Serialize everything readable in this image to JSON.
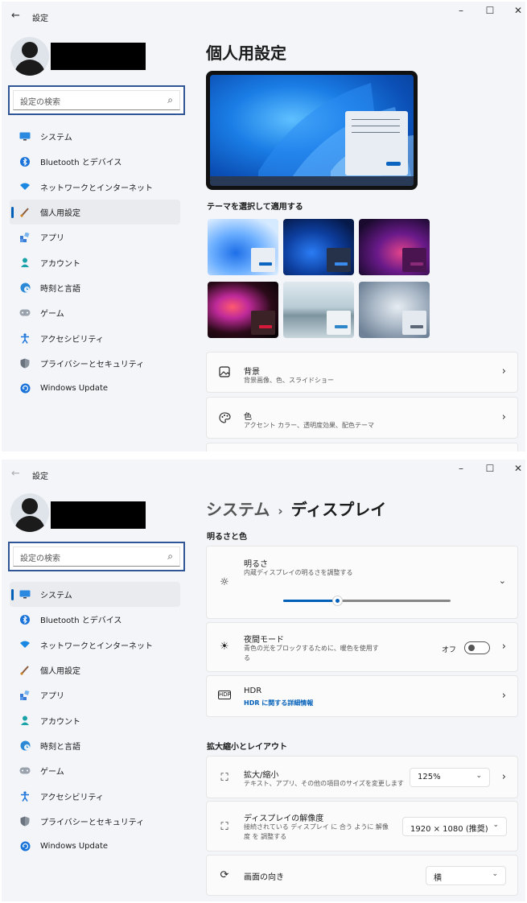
{
  "window1": {
    "title": "設定",
    "search_placeholder": "設定の検索",
    "nav": [
      {
        "label": "システム",
        "icon": "monitor-icon"
      },
      {
        "label": "Bluetooth とデバイス",
        "icon": "bluetooth-icon"
      },
      {
        "label": "ネットワークとインターネット",
        "icon": "wifi-icon"
      },
      {
        "label": "個人用設定",
        "icon": "brush-icon",
        "active": true
      },
      {
        "label": "アプリ",
        "icon": "apps-icon"
      },
      {
        "label": "アカウント",
        "icon": "person-icon"
      },
      {
        "label": "時刻と言語",
        "icon": "globe-clock-icon"
      },
      {
        "label": "ゲーム",
        "icon": "gamepad-icon"
      },
      {
        "label": "アクセシビリティ",
        "icon": "accessibility-icon"
      },
      {
        "label": "プライバシーとセキュリティ",
        "icon": "shield-icon"
      },
      {
        "label": "Windows Update",
        "icon": "update-icon"
      }
    ],
    "page_title": "個人用設定",
    "themes_heading": "テーマを選択して適用する",
    "cards": [
      {
        "title": "背景",
        "subtitle": "背景画像、色、スライドショー",
        "icon": "image-icon"
      },
      {
        "title": "色",
        "subtitle": "アクセント カラー、透明度効果、配色テーマ",
        "icon": "palette-icon"
      }
    ]
  },
  "window2": {
    "title": "設定",
    "search_placeholder": "設定の検索",
    "nav": [
      {
        "label": "システム",
        "icon": "monitor-icon",
        "active": true
      },
      {
        "label": "Bluetooth とデバイス",
        "icon": "bluetooth-icon"
      },
      {
        "label": "ネットワークとインターネット",
        "icon": "wifi-icon"
      },
      {
        "label": "個人用設定",
        "icon": "brush-icon"
      },
      {
        "label": "アプリ",
        "icon": "apps-icon"
      },
      {
        "label": "アカウント",
        "icon": "person-icon"
      },
      {
        "label": "時刻と言語",
        "icon": "globe-clock-icon"
      },
      {
        "label": "ゲーム",
        "icon": "gamepad-icon"
      },
      {
        "label": "アクセシビリティ",
        "icon": "accessibility-icon"
      },
      {
        "label": "プライバシーとセキュリティ",
        "icon": "shield-icon"
      },
      {
        "label": "Windows Update",
        "icon": "update-icon"
      }
    ],
    "breadcrumb": {
      "parent": "システム",
      "separator": "›",
      "current": "ディスプレイ"
    },
    "section_brightness": "明るさと色",
    "brightness": {
      "title": "明るさ",
      "subtitle": "内蔵ディスプレイの明るさを調整する",
      "value_fraction": 0.32
    },
    "night_light": {
      "title": "夜間モード",
      "subtitle_line1": "青色の光をブロックするために、暖色を使用す",
      "subtitle_line2": "る",
      "toggle_label": "オフ"
    },
    "hdr": {
      "title": "HDR",
      "link": "HDR に関する詳細情報"
    },
    "section_layout": "拡大縮小とレイアウト",
    "scale": {
      "title": "拡大/縮小",
      "subtitle": "テキスト、アプリ、その他の項目のサイズを変更します",
      "value": "125%"
    },
    "resolution": {
      "title": "ディスプレイの解像度",
      "subtitle_line1": "接続されている ディスプレイ に 合う ように 解像",
      "subtitle_line2": "度 を 調整する",
      "value": "1920 × 1080 (推奨)"
    },
    "orientation": {
      "title": "画面の向き",
      "value": "横"
    }
  },
  "window_controls": {
    "minimize": "–",
    "maximize": "☐",
    "close": "✕"
  },
  "colors": {
    "accent": "#005fb8",
    "highlight_border": "#2f5597",
    "background": "#f3f5f9"
  }
}
